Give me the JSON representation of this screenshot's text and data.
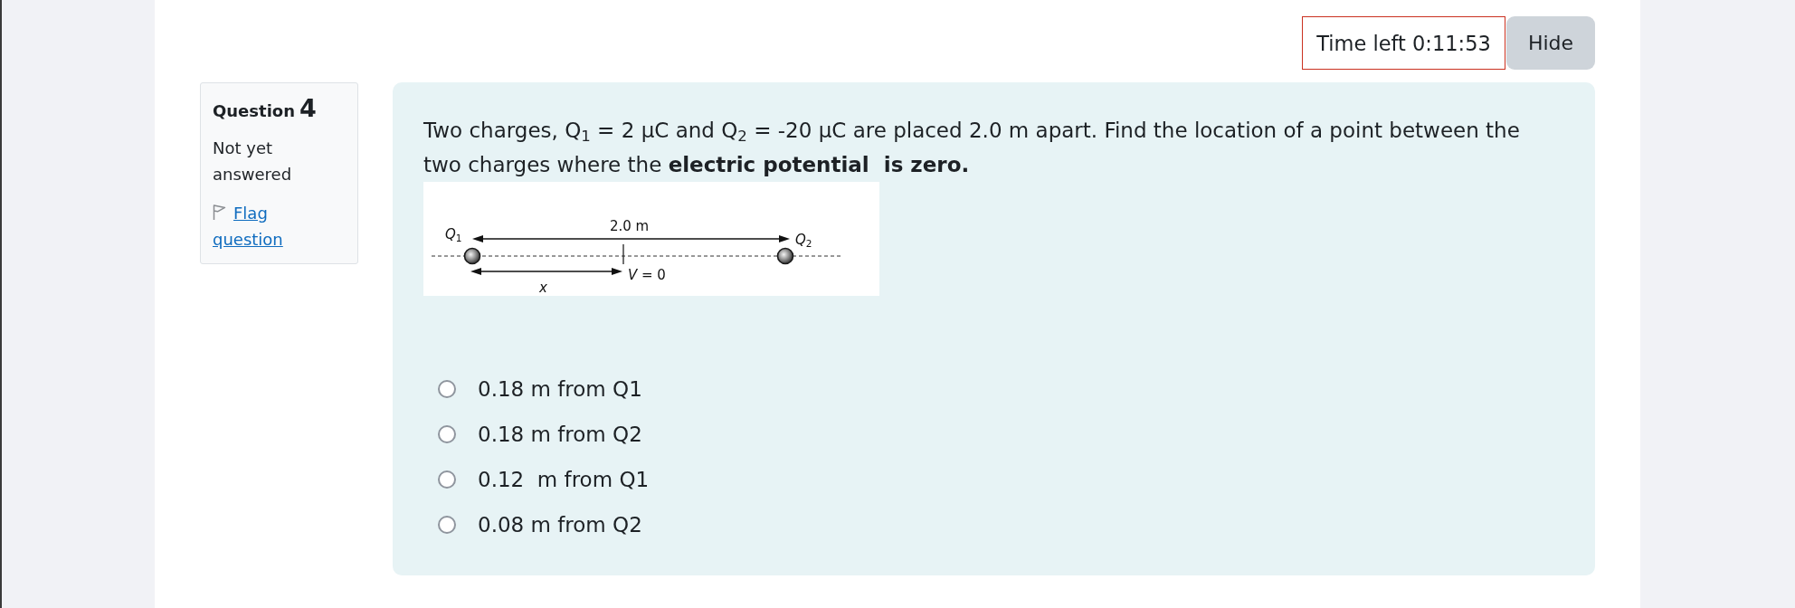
{
  "timer": {
    "label": "Time left 0:11:53"
  },
  "hide_button": {
    "label": "Hide"
  },
  "question_info": {
    "title": "Question",
    "number": "4",
    "status": "Not yet answered",
    "flag_link": "Flag question"
  },
  "question": {
    "text": "Two charges, Q$_{1}$ = 2 μC and Q$_{2}$ = -20 μC are placed 2.0 m apart. Find the location of a point between the two charges where the **electric potential  is zero.**",
    "figure": {
      "q1_label": "Q$_{1}$",
      "distance_label": "2.0 m",
      "q2_label": "Q$_{2}$",
      "potential_label": "*V* = 0",
      "x_label": "x"
    },
    "options": [
      {
        "label": "0.18 m from Q1",
        "selected": false
      },
      {
        "label": "0.18 m from Q2",
        "selected": false
      },
      {
        "label": "0.12  m from Q1",
        "selected": false
      },
      {
        "label": "0.08 m from Q2",
        "selected": false
      }
    ]
  }
}
